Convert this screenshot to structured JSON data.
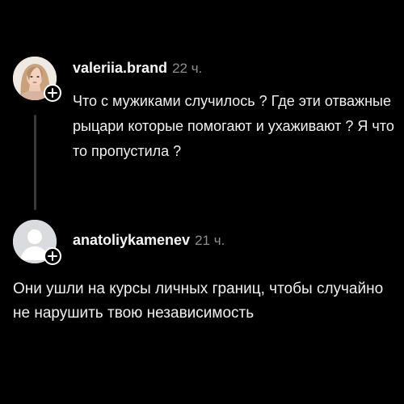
{
  "comments": [
    {
      "username": "valeriia.brand",
      "time": "22 ч.",
      "text": "Что с мужиками случилось ? Где эти отважные рыцари которые помогают и ухаживают ? Я что то пропустила ?",
      "avatar_icon": "user-photo-avatar",
      "badge_icon": "plus-icon"
    },
    {
      "username": "anatoliykamenev",
      "time": "21 ч.",
      "text": "Они ушли на курсы личных границ, чтобы случайно не нарушить твою независимость",
      "avatar_icon": "default-user-avatar",
      "badge_icon": "plus-icon"
    }
  ],
  "colors": {
    "background": "#000000",
    "text": "#f0f0f0",
    "muted": "#8e8e8e",
    "thread_line": "#3a3a3a"
  }
}
